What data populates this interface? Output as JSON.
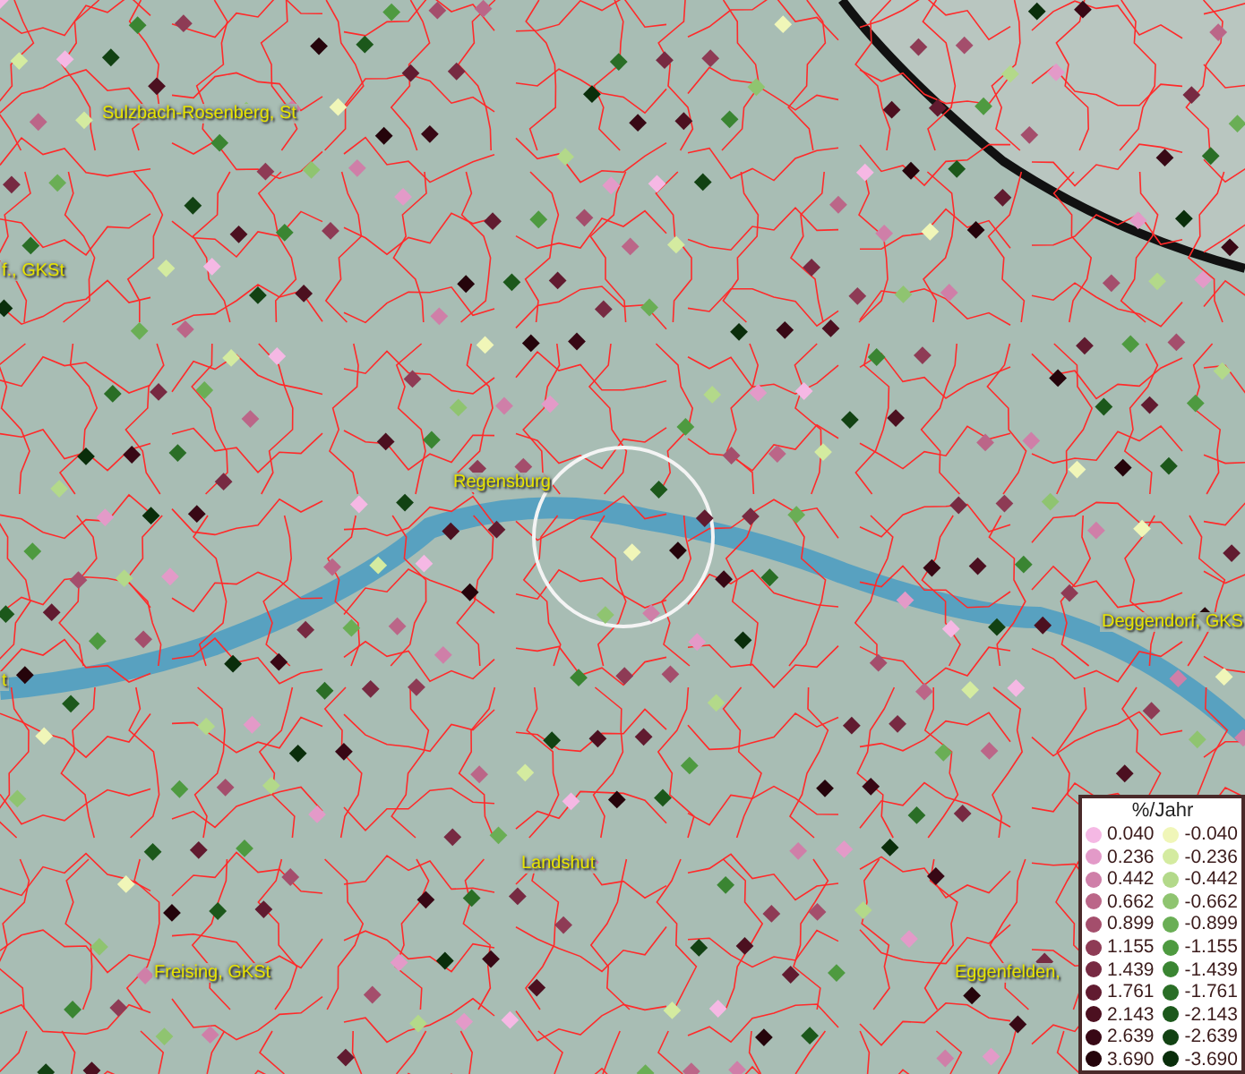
{
  "map": {
    "place_labels": [
      {
        "text": "Sulzbach-Rosenberg, St"
      },
      {
        "text": "f., GKSt"
      },
      {
        "text": "Regensburg"
      },
      {
        "text": "t"
      },
      {
        "text": "Deggendorf, GKS"
      },
      {
        "text": "Landshut"
      },
      {
        "text": "Freising, GKSt"
      },
      {
        "text": "Eggenfelden, "
      }
    ]
  },
  "legend": {
    "title": "%/Jahr",
    "rows": [
      {
        "positive": {
          "value": "0.040",
          "color": "#f5b8e4"
        },
        "negative": {
          "value": "-0.040",
          "color": "#f0f6b8"
        }
      },
      {
        "positive": {
          "value": "0.236",
          "color": "#e39ac8"
        },
        "negative": {
          "value": "-0.236",
          "color": "#d4eba0"
        }
      },
      {
        "positive": {
          "value": "0.442",
          "color": "#cf7fa8"
        },
        "negative": {
          "value": "-0.442",
          "color": "#b3d98a"
        }
      },
      {
        "positive": {
          "value": "0.662",
          "color": "#bb6688"
        },
        "negative": {
          "value": "-0.662",
          "color": "#8fc470"
        }
      },
      {
        "positive": {
          "value": "0.899",
          "color": "#a44e6c"
        },
        "negative": {
          "value": "-0.899",
          "color": "#6aae55"
        }
      },
      {
        "positive": {
          "value": "1.155",
          "color": "#8e3b55"
        },
        "negative": {
          "value": "-1.155",
          "color": "#4e9a40"
        }
      },
      {
        "positive": {
          "value": "1.439",
          "color": "#772a42"
        },
        "negative": {
          "value": "-1.439",
          "color": "#3a8532"
        }
      },
      {
        "positive": {
          "value": "1.761",
          "color": "#611b30"
        },
        "negative": {
          "value": "-1.761",
          "color": "#2a6e26"
        }
      },
      {
        "positive": {
          "value": "2.143",
          "color": "#4c1020"
        },
        "negative": {
          "value": "-2.143",
          "color": "#1c581b"
        }
      },
      {
        "positive": {
          "value": "2.639",
          "color": "#380815"
        },
        "negative": {
          "value": "-2.639",
          "color": "#124213"
        }
      },
      {
        "positive": {
          "value": "3.690",
          "color": "#25040b"
        },
        "negative": {
          "value": "-3.690",
          "color": "#0a2e0b"
        }
      }
    ]
  }
}
